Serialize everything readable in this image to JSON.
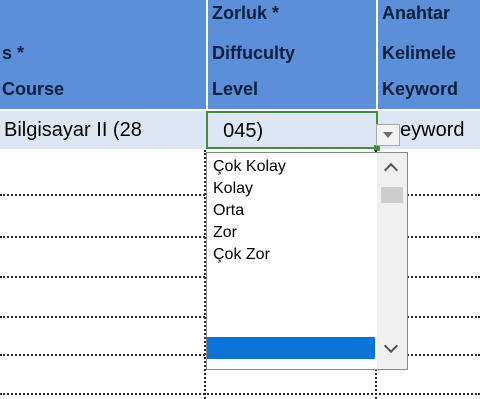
{
  "headers": {
    "col_course": {
      "line1": "s *",
      "line2": "Course"
    },
    "col_level": {
      "line0": "Zorluk *",
      "line1": "Diffuculty",
      "line2": "Level"
    },
    "col_keyword": {
      "line0": "Anahtar",
      "line1": "Kelimele",
      "line2": "Keyword"
    }
  },
  "row": {
    "course_value": "Bilgisayar II (28",
    "level_value": "045)",
    "level_hidden": "0",
    "keyword_value": "eyword"
  },
  "dropdown": {
    "options": [
      "Çok Kolay",
      "Kolay",
      "Orta",
      "Zor",
      "Çok Zor"
    ]
  },
  "colors": {
    "header_bg": "#5b8fd8",
    "row_bg": "#dde6f3",
    "active_border": "#3f8f3f",
    "selection": "#0a73d6"
  },
  "icons": {
    "dropdown_button": "chevron-down-icon",
    "scroll_up": "chevron-up-icon",
    "scroll_down": "chevron-down-icon"
  }
}
